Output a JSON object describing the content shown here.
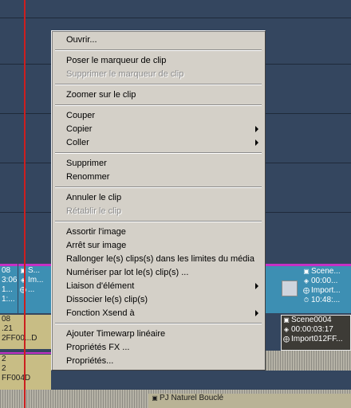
{
  "timeline": {
    "video_clips": {
      "left_a": [
        "08",
        "3:06",
        "1...",
        "1:..."
      ],
      "left_b": [
        "S...",
        "Im...",
        "..."
      ],
      "right": [
        "Scene...",
        "00:00...",
        "Import...",
        "10:48:..."
      ]
    },
    "audio_clips": {
      "left": [
        "08",
        ".21",
        "2FF00...D"
      ],
      "right": [
        "Scene0004",
        "00:00:03:17",
        "Import012FF..."
      ],
      "bottom_left": [
        "2",
        "2",
        "FF004D"
      ],
      "bottom_name": "PJ Naturel Bouclé"
    }
  },
  "context_menu": {
    "items": [
      {
        "label": "Ouvrir..."
      },
      {
        "label": "Poser le marqueur de clip"
      },
      {
        "label": "Supprimer le marqueur de clip",
        "disabled": true
      },
      {
        "label": "Zoomer sur le clip"
      },
      {
        "label": "Couper"
      },
      {
        "label": "Copier",
        "submenu": true
      },
      {
        "label": "Coller",
        "submenu": true
      },
      {
        "label": "Supprimer"
      },
      {
        "label": "Renommer"
      },
      {
        "label": "Annuler le clip"
      },
      {
        "label": "Rétablir le clip",
        "disabled": true
      },
      {
        "label": "Assortir l'image"
      },
      {
        "label": "Arrêt sur image"
      },
      {
        "label": "Rallonger le(s) clips(s) dans les limites du média"
      },
      {
        "label": "Numériser par lot le(s) clip(s) ..."
      },
      {
        "label": "Liaison d'élément",
        "submenu": true
      },
      {
        "label": "Dissocier le(s) clip(s)"
      },
      {
        "label": "Fonction Xsend à",
        "submenu": true
      },
      {
        "label": "Ajouter Timewarp linéaire"
      },
      {
        "label": "Propriétés FX ..."
      },
      {
        "label": "Propriétés..."
      }
    ]
  },
  "colors": {
    "background": "#34465f",
    "playhead": "#cc1f1f",
    "video_clip": "#3d8fb3",
    "audio_clip": "#c8bd85",
    "clip_header": "#c531c5",
    "menu_bg": "#d4d0c8"
  }
}
